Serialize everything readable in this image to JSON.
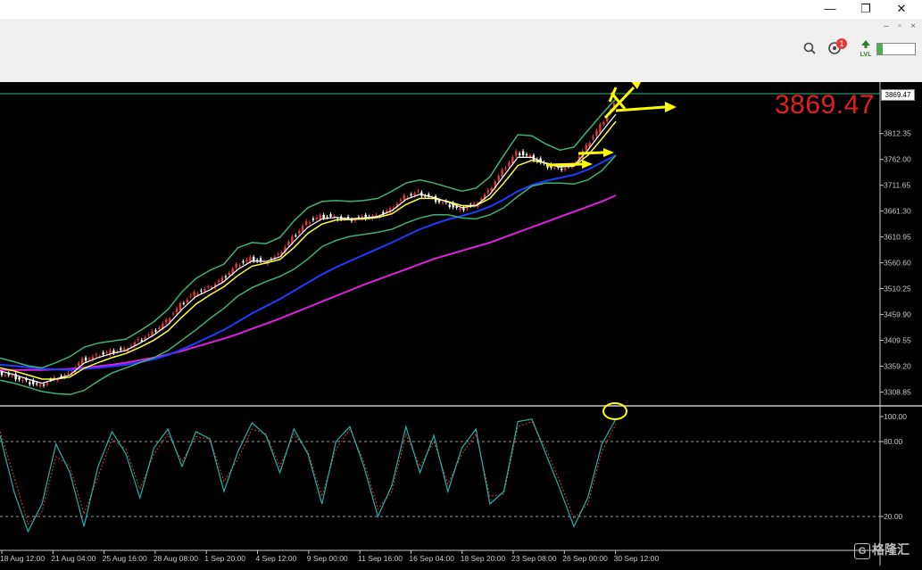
{
  "window": {
    "minimize_glyph": "—",
    "restore_glyph": "❐",
    "close_glyph": "✕"
  },
  "mdi": {
    "minimize_glyph": "–",
    "restore_glyph": "▫",
    "close_glyph": "×"
  },
  "toolbar": {
    "search_icon": "search-icon",
    "notifications_count": "1",
    "level_label": "LVL",
    "level_fill_fraction": 0.15
  },
  "colors": {
    "price_red": "#e3201b",
    "candle_up": "#e53935",
    "candle_down": "#ffffff",
    "bollinger": "#3cb371",
    "ma_fast": "#ffffff",
    "ma_mid": "#ffff33",
    "ma_blue": "#1e3cff",
    "ma_magenta": "#e020e0",
    "stoch_main": "#20b2aa",
    "stoch_signal": "#e53935",
    "arrow_yellow": "#ffff00"
  },
  "price": {
    "current": "3869.47",
    "tag": "3869.47"
  },
  "chart_data": [
    {
      "type": "line",
      "name_panel": "main",
      "yticks": [
        "3812.35",
        "3762.00",
        "3711.65",
        "3661.30",
        "3610.95",
        "3560.60",
        "3510.25",
        "3459.90",
        "3409.55",
        "3359.20",
        "3308.85"
      ],
      "ylim": [
        3283.68,
        3890.0
      ],
      "xticks": [
        "18 Aug 12:00",
        "21 Aug 04:00",
        "25 Aug 16:00",
        "28 Aug 08:00",
        "1 Sep 20:00",
        "4 Sep 12:00",
        "9 Sep 00:00",
        "11 Sep 16:00",
        "16 Sep 04:00",
        "18 Sep 20:00",
        "23 Sep 08:00",
        "26 Sep 00:00",
        "30 Sep 12:00"
      ],
      "series": [
        {
          "key": "price",
          "values": [
            3348,
            3340,
            3330,
            3322,
            3336,
            3344,
            3372,
            3380,
            3388,
            3392,
            3410,
            3425,
            3448,
            3480,
            3502,
            3512,
            3530,
            3556,
            3570,
            3562,
            3576,
            3610,
            3640,
            3652,
            3650,
            3645,
            3650,
            3652,
            3665,
            3690,
            3698,
            3686,
            3676,
            3665,
            3674,
            3700,
            3740,
            3776,
            3768,
            3752,
            3744,
            3750,
            3788,
            3828,
            3869
          ]
        },
        {
          "key": "ma_fast",
          "values": [
            3350,
            3343,
            3334,
            3326,
            3334,
            3342,
            3365,
            3376,
            3384,
            3390,
            3404,
            3420,
            3440,
            3470,
            3495,
            3508,
            3524,
            3548,
            3564,
            3563,
            3572,
            3602,
            3630,
            3646,
            3649,
            3646,
            3648,
            3651,
            3662,
            3684,
            3694,
            3688,
            3679,
            3668,
            3672,
            3694,
            3730,
            3766,
            3766,
            3754,
            3747,
            3750,
            3780,
            3816,
            3850
          ]
        },
        {
          "key": "ma_mid",
          "values": [
            3356,
            3350,
            3342,
            3334,
            3334,
            3338,
            3355,
            3366,
            3376,
            3384,
            3396,
            3410,
            3428,
            3455,
            3480,
            3498,
            3514,
            3536,
            3554,
            3560,
            3567,
            3590,
            3618,
            3636,
            3644,
            3645,
            3646,
            3649,
            3656,
            3674,
            3686,
            3686,
            3680,
            3672,
            3672,
            3686,
            3716,
            3750,
            3760,
            3755,
            3748,
            3749,
            3770,
            3802,
            3836
          ]
        },
        {
          "key": "bb_upper",
          "values": [
            3375,
            3368,
            3360,
            3356,
            3366,
            3378,
            3396,
            3404,
            3408,
            3412,
            3428,
            3446,
            3470,
            3504,
            3530,
            3546,
            3558,
            3590,
            3600,
            3598,
            3610,
            3642,
            3668,
            3680,
            3682,
            3680,
            3682,
            3686,
            3700,
            3716,
            3722,
            3716,
            3708,
            3700,
            3706,
            3728,
            3770,
            3810,
            3808,
            3792,
            3780,
            3786,
            3818,
            3850,
            3880
          ]
        },
        {
          "key": "bb_lower",
          "values": [
            3332,
            3326,
            3318,
            3310,
            3306,
            3304,
            3312,
            3330,
            3346,
            3356,
            3366,
            3376,
            3390,
            3410,
            3430,
            3452,
            3472,
            3496,
            3512,
            3524,
            3534,
            3548,
            3568,
            3592,
            3604,
            3612,
            3616,
            3620,
            3626,
            3638,
            3648,
            3654,
            3654,
            3648,
            3646,
            3654,
            3668,
            3690,
            3710,
            3716,
            3716,
            3714,
            3722,
            3740,
            3770
          ]
        },
        {
          "key": "ma_blue",
          "values": [
            3362,
            3360,
            3357,
            3354,
            3353,
            3352,
            3354,
            3356,
            3359,
            3362,
            3367,
            3373,
            3381,
            3392,
            3404,
            3417,
            3430,
            3446,
            3462,
            3476,
            3490,
            3506,
            3522,
            3538,
            3552,
            3564,
            3576,
            3588,
            3600,
            3613,
            3626,
            3636,
            3645,
            3652,
            3660,
            3670,
            3684,
            3700,
            3712,
            3720,
            3726,
            3732,
            3742,
            3756,
            3770
          ]
        },
        {
          "key": "ma_magenta",
          "values": [
            3352,
            3352,
            3352,
            3352,
            3353,
            3354,
            3356,
            3359,
            3362,
            3366,
            3371,
            3376,
            3382,
            3389,
            3397,
            3405,
            3413,
            3422,
            3432,
            3442,
            3452,
            3463,
            3474,
            3485,
            3496,
            3507,
            3518,
            3528,
            3538,
            3548,
            3558,
            3568,
            3576,
            3584,
            3592,
            3600,
            3610,
            3620,
            3630,
            3640,
            3650,
            3660,
            3670,
            3680,
            3692
          ]
        }
      ]
    },
    {
      "type": "line",
      "name_panel": "stochastic",
      "yticks": [
        "100.00",
        "80.00",
        "20.00"
      ],
      "ylim": [
        -5,
        105
      ],
      "levels": [
        80,
        20
      ],
      "series": [
        {
          "key": "stoch_main",
          "values": [
            85,
            40,
            8,
            30,
            78,
            55,
            12,
            60,
            88,
            70,
            35,
            75,
            90,
            60,
            88,
            82,
            40,
            72,
            95,
            85,
            55,
            90,
            70,
            30,
            80,
            92,
            60,
            20,
            45,
            92,
            55,
            85,
            40,
            75,
            90,
            30,
            40,
            96,
            98,
            70,
            42,
            12,
            35,
            78,
            98
          ]
        },
        {
          "key": "stoch_signal",
          "values": [
            88,
            52,
            14,
            24,
            68,
            60,
            22,
            52,
            82,
            74,
            42,
            70,
            86,
            64,
            84,
            82,
            48,
            66,
            90,
            86,
            60,
            86,
            72,
            36,
            74,
            90,
            64,
            26,
            40,
            86,
            60,
            80,
            46,
            70,
            86,
            36,
            38,
            92,
            96,
            74,
            48,
            18,
            30,
            72,
            94
          ]
        }
      ]
    }
  ]
}
